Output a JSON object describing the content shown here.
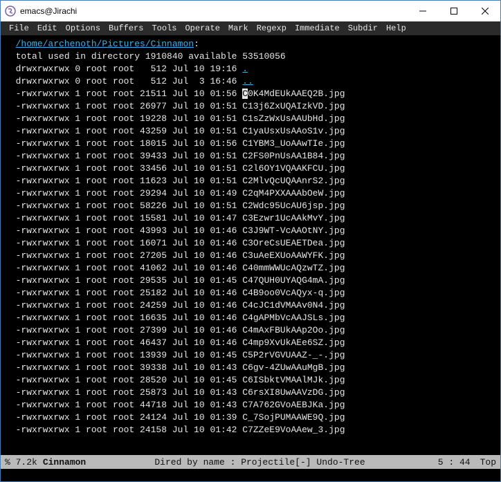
{
  "window": {
    "title": "emacs@Jirachi"
  },
  "menus": [
    "File",
    "Edit",
    "Options",
    "Buffers",
    "Tools",
    "Operate",
    "Mark",
    "Regexp",
    "Immediate",
    "Subdir",
    "Help"
  ],
  "dired": {
    "path": "/home/archenoth/Pictures/Cinnamon",
    "path_suffix": ":",
    "total_line": "total used in directory 1910840 available 53510056",
    "dirs": [
      {
        "perm": "drwxrwxrwx",
        "links": "0",
        "owner": "root",
        "group": "root",
        "size": "512",
        "date": "Jul 10 19:16",
        "name": "."
      },
      {
        "perm": "drwxrwxrwx",
        "links": "0",
        "owner": "root",
        "group": "root",
        "size": "512",
        "date": "Jul  3 16:46",
        "name": ".."
      }
    ],
    "files": [
      {
        "perm": "-rwxrwxrwx",
        "links": "1",
        "owner": "root",
        "group": "root",
        "size": "21511",
        "date": "Jul 10 01:56",
        "cursor_char": "C",
        "name_rest": "0K4MdEUkAAEQ2B.jpg"
      },
      {
        "perm": "-rwxrwxrwx",
        "links": "1",
        "owner": "root",
        "group": "root",
        "size": "26977",
        "date": "Jul 10 01:51",
        "name": "C13j6ZxUQAIzkVD.jpg"
      },
      {
        "perm": "-rwxrwxrwx",
        "links": "1",
        "owner": "root",
        "group": "root",
        "size": "19228",
        "date": "Jul 10 01:51",
        "name": "C1sZzWxUsAAUbHd.jpg"
      },
      {
        "perm": "-rwxrwxrwx",
        "links": "1",
        "owner": "root",
        "group": "root",
        "size": "43259",
        "date": "Jul 10 01:51",
        "name": "C1yaUsxUsAAoS1v.jpg"
      },
      {
        "perm": "-rwxrwxrwx",
        "links": "1",
        "owner": "root",
        "group": "root",
        "size": "18015",
        "date": "Jul 10 01:56",
        "name": "C1YBM3_UoAAwTIe.jpg"
      },
      {
        "perm": "-rwxrwxrwx",
        "links": "1",
        "owner": "root",
        "group": "root",
        "size": "39433",
        "date": "Jul 10 01:51",
        "name": "C2FS0PnUsAA1B84.jpg"
      },
      {
        "perm": "-rwxrwxrwx",
        "links": "1",
        "owner": "root",
        "group": "root",
        "size": "33456",
        "date": "Jul 10 01:51",
        "name": "C2l6OY1VQAAKFCU.jpg"
      },
      {
        "perm": "-rwxrwxrwx",
        "links": "1",
        "owner": "root",
        "group": "root",
        "size": "11623",
        "date": "Jul 10 01:51",
        "name": "C2MlvQcUQAAnrS2.jpg"
      },
      {
        "perm": "-rwxrwxrwx",
        "links": "1",
        "owner": "root",
        "group": "root",
        "size": "29294",
        "date": "Jul 10 01:49",
        "name": "C2qM4PXXAAAbOeW.jpg"
      },
      {
        "perm": "-rwxrwxrwx",
        "links": "1",
        "owner": "root",
        "group": "root",
        "size": "58226",
        "date": "Jul 10 01:51",
        "name": "C2Wdc95UcAU6jsp.jpg"
      },
      {
        "perm": "-rwxrwxrwx",
        "links": "1",
        "owner": "root",
        "group": "root",
        "size": "15581",
        "date": "Jul 10 01:47",
        "name": "C3Ezwr1UcAAkMvY.jpg"
      },
      {
        "perm": "-rwxrwxrwx",
        "links": "1",
        "owner": "root",
        "group": "root",
        "size": "43993",
        "date": "Jul 10 01:46",
        "name": "C3J9WT-VcAAOtNY.jpg"
      },
      {
        "perm": "-rwxrwxrwx",
        "links": "1",
        "owner": "root",
        "group": "root",
        "size": "16071",
        "date": "Jul 10 01:46",
        "name": "C3OreCsUEAETDea.jpg"
      },
      {
        "perm": "-rwxrwxrwx",
        "links": "1",
        "owner": "root",
        "group": "root",
        "size": "27205",
        "date": "Jul 10 01:46",
        "name": "C3uAeEXUoAAWYFK.jpg"
      },
      {
        "perm": "-rwxrwxrwx",
        "links": "1",
        "owner": "root",
        "group": "root",
        "size": "41062",
        "date": "Jul 10 01:46",
        "name": "C40mmWWUcAQzwTZ.jpg"
      },
      {
        "perm": "-rwxrwxrwx",
        "links": "1",
        "owner": "root",
        "group": "root",
        "size": "29535",
        "date": "Jul 10 01:45",
        "name": "C47QUH0UYAQG4mA.jpg"
      },
      {
        "perm": "-rwxrwxrwx",
        "links": "1",
        "owner": "root",
        "group": "root",
        "size": "25182",
        "date": "Jul 10 01:46",
        "name": "C4B9oo0VcAQyx-q.jpg"
      },
      {
        "perm": "-rwxrwxrwx",
        "links": "1",
        "owner": "root",
        "group": "root",
        "size": "24259",
        "date": "Jul 10 01:46",
        "name": "C4cJC1dVMAAv0N4.jpg"
      },
      {
        "perm": "-rwxrwxrwx",
        "links": "1",
        "owner": "root",
        "group": "root",
        "size": "16635",
        "date": "Jul 10 01:46",
        "name": "C4gAPMbVcAAJSLs.jpg"
      },
      {
        "perm": "-rwxrwxrwx",
        "links": "1",
        "owner": "root",
        "group": "root",
        "size": "27399",
        "date": "Jul 10 01:46",
        "name": "C4mAxFBUkAAp2Oo.jpg"
      },
      {
        "perm": "-rwxrwxrwx",
        "links": "1",
        "owner": "root",
        "group": "root",
        "size": "46437",
        "date": "Jul 10 01:46",
        "name": "C4mp9XvUkAEe6SZ.jpg"
      },
      {
        "perm": "-rwxrwxrwx",
        "links": "1",
        "owner": "root",
        "group": "root",
        "size": "13939",
        "date": "Jul 10 01:45",
        "name": "C5P2rVGVUAAZ-_-.jpg"
      },
      {
        "perm": "-rwxrwxrwx",
        "links": "1",
        "owner": "root",
        "group": "root",
        "size": "39338",
        "date": "Jul 10 01:43",
        "name": "C6gv-4ZUwAAuMgB.jpg"
      },
      {
        "perm": "-rwxrwxrwx",
        "links": "1",
        "owner": "root",
        "group": "root",
        "size": "28520",
        "date": "Jul 10 01:45",
        "name": "C6ISbktVMAAlMJk.jpg"
      },
      {
        "perm": "-rwxrwxrwx",
        "links": "1",
        "owner": "root",
        "group": "root",
        "size": "25873",
        "date": "Jul 10 01:43",
        "name": "C6rsXI8UwAAVzDG.jpg"
      },
      {
        "perm": "-rwxrwxrwx",
        "links": "1",
        "owner": "root",
        "group": "root",
        "size": "44718",
        "date": "Jul 10 01:43",
        "name": "C7A762GVoAEBJKa.jpg"
      },
      {
        "perm": "-rwxrwxrwx",
        "links": "1",
        "owner": "root",
        "group": "root",
        "size": "24124",
        "date": "Jul 10 01:39",
        "name": "C_7SojPUMAAWE9Q.jpg"
      },
      {
        "perm": "-rwxrwxrwx",
        "links": "1",
        "owner": "root",
        "group": "root",
        "size": "24158",
        "date": "Jul 10 01:42",
        "name": "C7ZZeE9VoAAew_3.jpg"
      }
    ]
  },
  "modeline": {
    "left1": "% 7.2k",
    "left2": "Cinnamon",
    "center": "Dired by name : Projectile[-] Undo-Tree",
    "pos": "5 : 44",
    "scroll": "Top"
  }
}
